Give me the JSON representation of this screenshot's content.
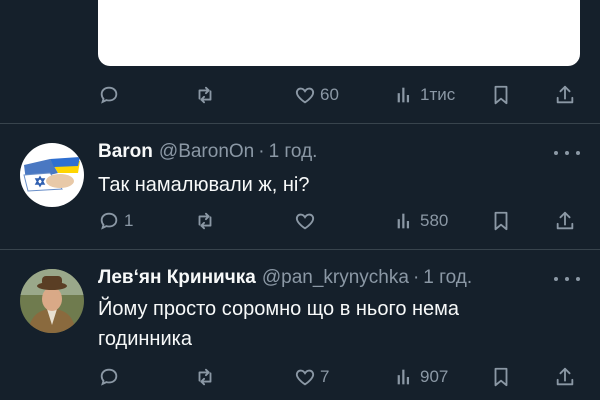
{
  "tweet1": {
    "actions": {
      "reply_count": "",
      "retweet_count": "",
      "like_count": "60",
      "views_count": "1тис"
    }
  },
  "tweet2": {
    "name": "Baron",
    "handle": "@BaronOn",
    "separator": "·",
    "time": "1 год.",
    "text": "Так намалювали ж, ні?",
    "actions": {
      "reply_count": "1",
      "retweet_count": "",
      "like_count": "",
      "views_count": "580"
    }
  },
  "tweet3": {
    "name": "Лев‘ян Криничка",
    "handle": "@pan_krynychka",
    "separator": "·",
    "time": "1 год.",
    "text": "Йому просто соромно що в нього нема годинника",
    "actions": {
      "reply_count": "",
      "retweet_count": "",
      "like_count": "7",
      "views_count": "907"
    }
  },
  "colors": {
    "background": "#15202b",
    "text_primary": "#f7f9f9",
    "text_secondary": "#8b98a5",
    "divider": "#38444d"
  },
  "icons": [
    "reply-icon",
    "retweet-icon",
    "like-icon",
    "views-icon",
    "bookmark-icon",
    "share-icon",
    "more-icon"
  ]
}
